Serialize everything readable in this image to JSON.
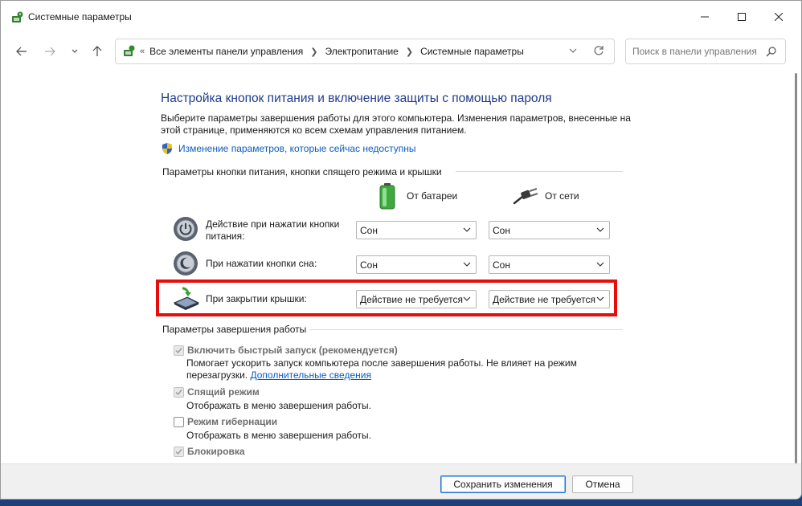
{
  "window": {
    "title": "Системные параметры"
  },
  "nav": {
    "breadcrumb_prefix": "«",
    "breadcrumbs": [
      "Все элементы панели управления",
      "Электропитание",
      "Системные параметры"
    ],
    "search_placeholder": "Поиск в панели управления"
  },
  "page": {
    "heading": "Настройка кнопок питания и включение защиты с помощью пароля",
    "description": "Выберите параметры завершения работы для этого компьютера. Изменения параметров, внесенные на этой странице, применяются ко всем схемам управления питанием.",
    "unavailable_link": "Изменение параметров, которые сейчас недоступны"
  },
  "buttons_section": {
    "title": "Параметры кнопки питания, кнопки спящего режима и крышки",
    "col_battery": "От батареи",
    "col_ac": "От сети",
    "rows": [
      {
        "label": "Действие при нажатии кнопки питания:",
        "battery": "Сон",
        "ac": "Сон"
      },
      {
        "label": "При нажатии кнопки сна:",
        "battery": "Сон",
        "ac": "Сон"
      },
      {
        "label": "При закрытии крышки:",
        "battery": "Действие не требуется",
        "ac": "Действие не требуется"
      }
    ]
  },
  "shutdown_section": {
    "title": "Параметры завершения работы",
    "items": [
      {
        "label": "Включить быстрый запуск (рекомендуется)",
        "checked": true,
        "desc_line1": "Помогает ускорить запуск компьютера после завершения работы. Не влияет на режим",
        "desc_line2": "перезагрузки.",
        "desc_link": "Дополнительные сведения"
      },
      {
        "label": "Спящий режим",
        "checked": true,
        "desc_line1": "Отображать в меню завершения работы."
      },
      {
        "label": "Режим гибернации",
        "checked": false,
        "desc_line1": "Отображать в меню завершения работы."
      },
      {
        "label": "Блокировка",
        "checked": true
      }
    ]
  },
  "footer": {
    "save_label": "Сохранить изменения",
    "cancel_label": "Отмена"
  },
  "colors": {
    "heading": "#1e3c8c",
    "link": "#0a5bc4",
    "highlight_border": "#e80d0d"
  }
}
